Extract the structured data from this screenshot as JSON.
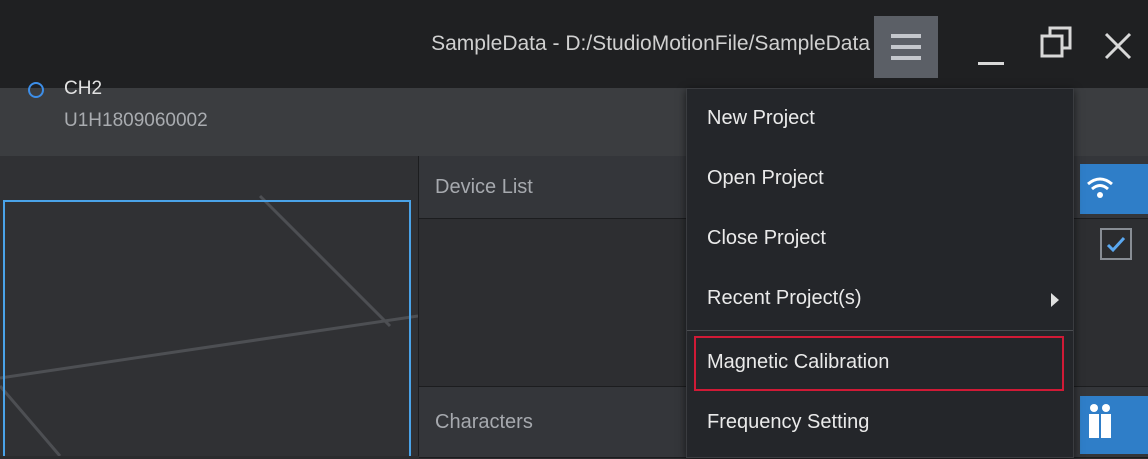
{
  "window": {
    "title": "SampleData - D:/StudioMotionFile/SampleData",
    "controls": [
      "minimize-icon",
      "restore-icon",
      "close-icon"
    ]
  },
  "panel": {
    "device_list_label": "Device List",
    "devices": [
      {
        "name": "CH2",
        "serial": "U1H1809060002"
      }
    ],
    "characters_label": "Characters"
  },
  "menu": {
    "items": [
      {
        "label": "New Project"
      },
      {
        "label": "Open Project"
      },
      {
        "label": "Close Project"
      },
      {
        "label": "Recent Project(s)",
        "has_submenu": true
      },
      {
        "label": "Magnetic Calibration",
        "highlighted": true
      },
      {
        "label": "Frequency Setting"
      }
    ]
  },
  "colors": {
    "accent": "#2f7ec8",
    "highlight_border": "#d01a36",
    "radio": "#3d8ee8"
  },
  "icons": [
    "hamburger-menu-icon",
    "wifi-icon",
    "checkbox-checked-icon",
    "characters-icon"
  ]
}
